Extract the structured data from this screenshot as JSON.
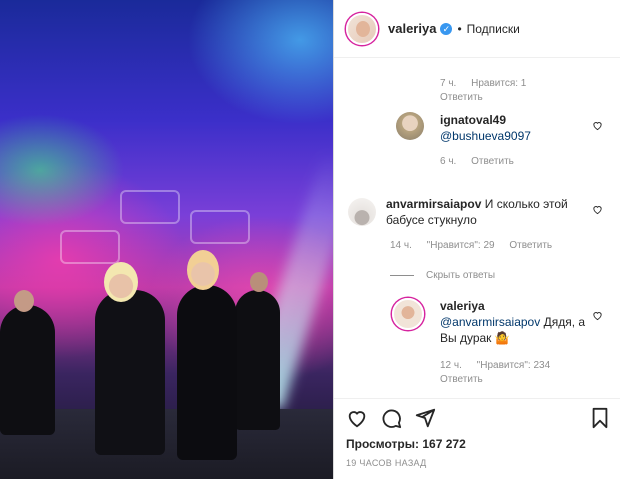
{
  "header": {
    "username": "valeriya",
    "verified_glyph": "✓",
    "separator": "•",
    "follow_label": "Подписки"
  },
  "comments": [
    {
      "time": "7 ч.",
      "likes": "Нравится: 1",
      "reply_label": "Ответить"
    },
    {
      "username": "ignatoval49",
      "text": "@bushueva9097",
      "time": "6 ч.",
      "reply_label": "Ответить"
    },
    {
      "username": "anvarmirsaiapov",
      "text": "И сколько этой бабусе стукнуло",
      "time": "14 ч.",
      "likes": "\"Нравится\": 29",
      "reply_label": "Ответить"
    },
    {
      "hide_replies": "Скрыть ответы"
    },
    {
      "username": "valeriya",
      "mention": "@anvarmirsaiapov",
      "text": "Дядя, а Вы дурак",
      "emoji": "🤷",
      "time": "12 ч.",
      "likes": "\"Нравится\": 234",
      "reply_label": "Ответить"
    }
  ],
  "footer": {
    "views_label": "Просмотры:",
    "views_count": "167 272",
    "posted": "19 ЧАСОВ НАЗАД"
  },
  "icons": [
    "heart-icon",
    "comment-icon",
    "share-icon",
    "bookmark-icon",
    "verified-icon"
  ],
  "colors": {
    "accent": "#3897f0",
    "mention": "#00376b",
    "meta": "#8e8e8e",
    "ring": "#d6249f"
  }
}
